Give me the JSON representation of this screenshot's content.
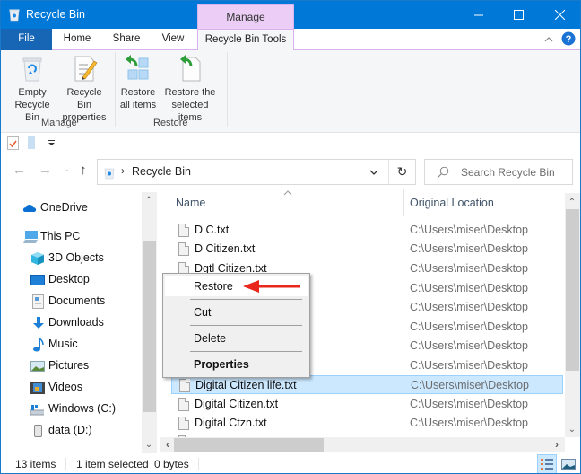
{
  "window": {
    "title": "Recycle Bin",
    "contextual_tab_group": "Manage",
    "minimize_icon": "minimize-icon",
    "maximize_icon": "maximize-icon",
    "close_icon": "close-icon"
  },
  "tabs": [
    {
      "label": "File"
    },
    {
      "label": "Home"
    },
    {
      "label": "Share"
    },
    {
      "label": "View"
    },
    {
      "label": "Recycle Bin Tools",
      "active": true
    }
  ],
  "ribbon": {
    "groups": [
      {
        "label": "Manage",
        "buttons": [
          {
            "label_line1": "Empty",
            "label_line2": "Recycle Bin",
            "icon": "recycle-bin-icon"
          },
          {
            "label_line1": "Recycle Bin",
            "label_line2": "properties",
            "icon": "properties-icon"
          }
        ]
      },
      {
        "label": "Restore",
        "buttons": [
          {
            "label_line1": "Restore",
            "label_line2": "all items",
            "icon": "restore-all-icon"
          },
          {
            "label_line1": "Restore the",
            "label_line2": "selected items",
            "icon": "restore-selected-icon"
          }
        ]
      }
    ]
  },
  "address": {
    "location": "Recycle Bin",
    "search_placeholder": "Search Recycle Bin"
  },
  "navpane": {
    "items": [
      {
        "label": "OneDrive",
        "icon": "onedrive-icon",
        "level": 0
      },
      {
        "label": "This PC",
        "icon": "this-pc-icon",
        "level": 0
      },
      {
        "label": "3D Objects",
        "icon": "3d-objects-icon",
        "level": 1
      },
      {
        "label": "Desktop",
        "icon": "desktop-icon",
        "level": 1
      },
      {
        "label": "Documents",
        "icon": "documents-icon",
        "level": 1
      },
      {
        "label": "Downloads",
        "icon": "downloads-icon",
        "level": 1
      },
      {
        "label": "Music",
        "icon": "music-icon",
        "level": 1
      },
      {
        "label": "Pictures",
        "icon": "pictures-icon",
        "level": 1
      },
      {
        "label": "Videos",
        "icon": "videos-icon",
        "level": 1
      },
      {
        "label": "Windows (C:)",
        "icon": "drive-c-icon",
        "level": 1
      },
      {
        "label": "data (D:)",
        "icon": "drive-d-icon",
        "level": 1
      }
    ]
  },
  "columns": {
    "name": "Name",
    "location": "Original Location"
  },
  "files": [
    {
      "name": "D C.txt",
      "location": "C:\\Users\\miser\\Desktop"
    },
    {
      "name": "D Citizen.txt",
      "location": "C:\\Users\\miser\\Desktop"
    },
    {
      "name": "Dgtl Citizen.txt",
      "location": "C:\\Users\\miser\\Desktop"
    },
    {
      "name": "",
      "location": "C:\\Users\\miser\\Desktop"
    },
    {
      "name": "",
      "location": "C:\\Users\\miser\\Desktop"
    },
    {
      "name": "",
      "location": "C:\\Users\\miser\\Desktop"
    },
    {
      "name": "",
      "location": "C:\\Users\\miser\\Desktop"
    },
    {
      "name": "",
      "location": "C:\\Users\\miser\\Desktop"
    },
    {
      "name": "Digital Citizen life.txt",
      "location": "C:\\Users\\miser\\Desktop",
      "selected": true
    },
    {
      "name": "Digital Citizen.txt",
      "location": "C:\\Users\\miser\\Desktop"
    },
    {
      "name": "Digital Ctzn.txt",
      "location": "C:\\Users\\miser\\Desktop"
    }
  ],
  "context_menu": {
    "items": [
      {
        "label": "Restore",
        "highlighted": true
      },
      {
        "label": "Cut"
      },
      {
        "label": "Delete"
      },
      {
        "label": "Properties",
        "bold": true
      }
    ]
  },
  "annotation": {
    "arrow_color": "#e8261c"
  },
  "status": {
    "item_count": "13 items",
    "selection": "1 item selected",
    "size": "0 bytes"
  },
  "colors": {
    "titlebar": "#0078d7",
    "manage_tab": "#ebcdf5",
    "selection": "#cce8ff"
  }
}
